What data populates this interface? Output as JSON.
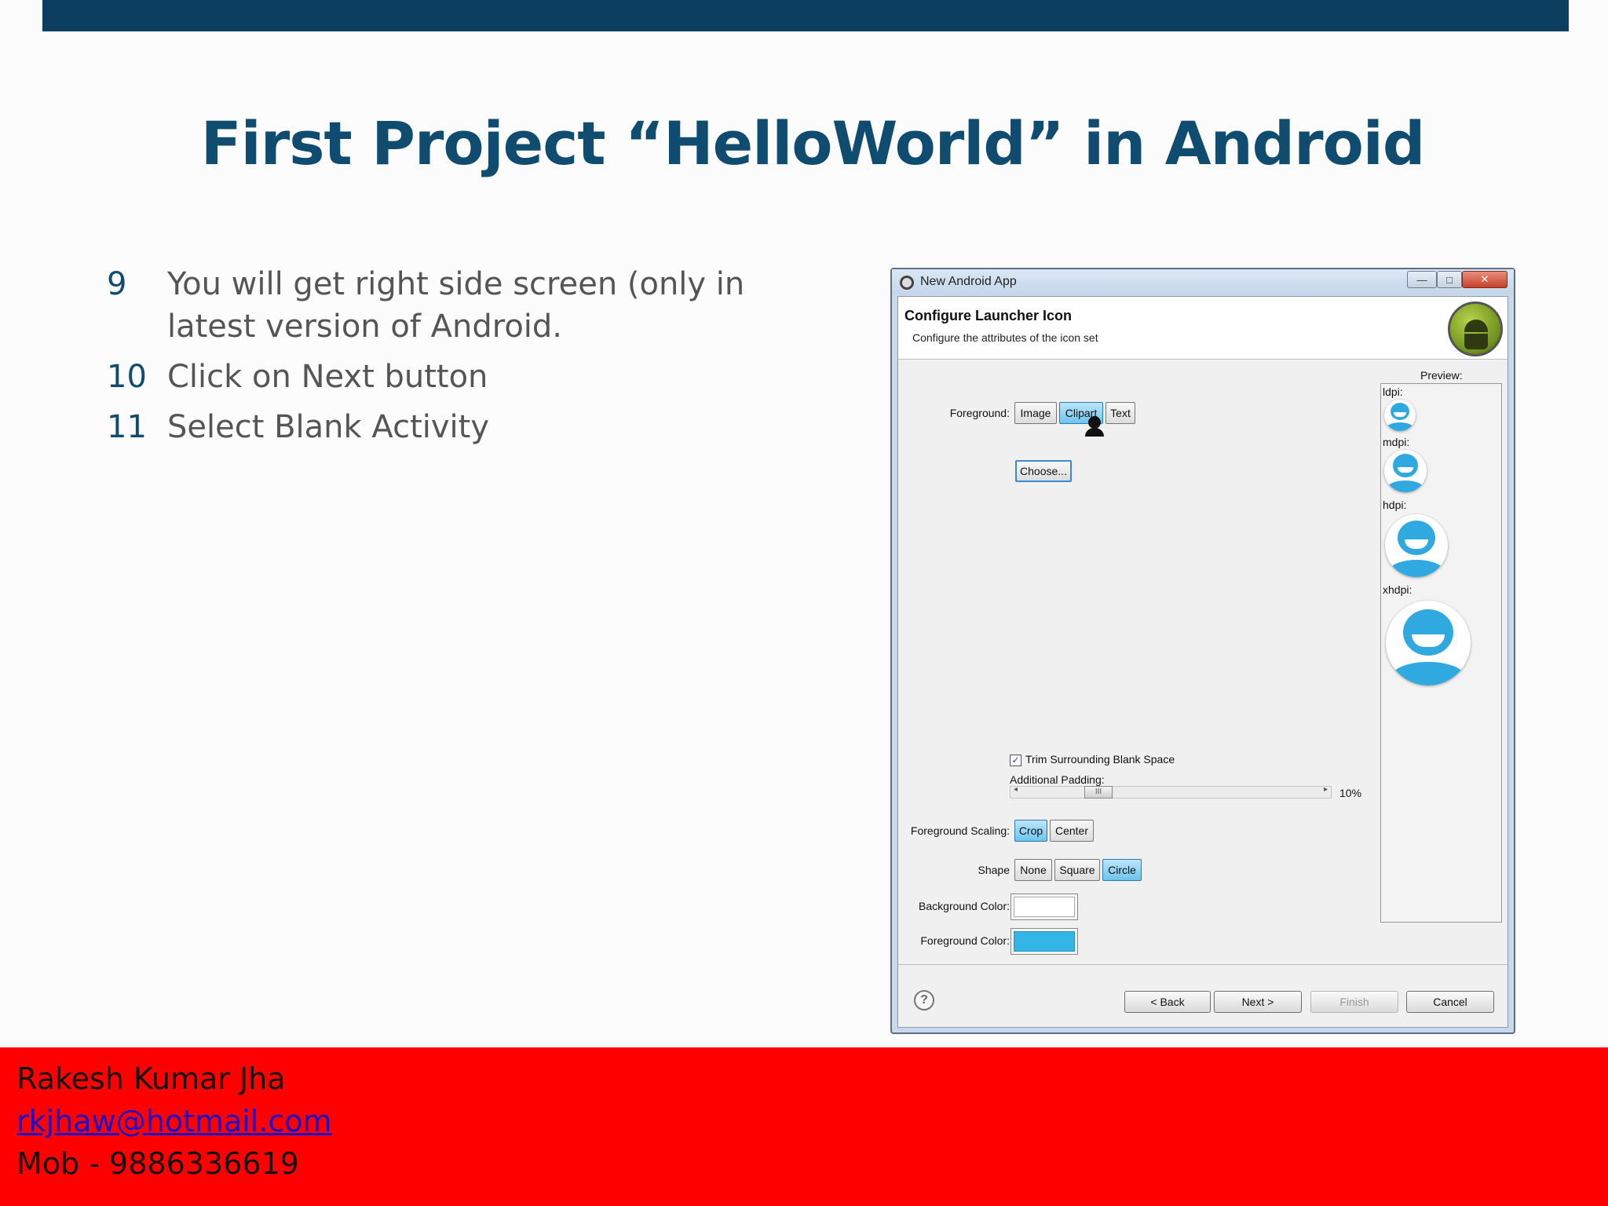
{
  "slide": {
    "title": "First Project “HelloWorld” in Android",
    "bullets": [
      {
        "num": "9",
        "text": "You will get right side screen (only in latest version of Android."
      },
      {
        "num": "10",
        "text": "Click on Next button"
      },
      {
        "num": "11",
        "text": "Select Blank Activity"
      }
    ]
  },
  "dialog": {
    "window_title": "New Android App",
    "header_title": "Configure Launcher Icon",
    "header_subtitle": "Configure the attributes of the icon set",
    "foreground": {
      "label": "Foreground:",
      "options": [
        "Image",
        "Clipart",
        "Text"
      ],
      "selected": "Clipart"
    },
    "choose_label": "Choose...",
    "trim": {
      "label": "Trim Surrounding Blank Space",
      "checked": true
    },
    "padding": {
      "label": "Additional Padding:",
      "value": "10%",
      "thumb": "III"
    },
    "scaling": {
      "label": "Foreground Scaling:",
      "options": [
        "Crop",
        "Center"
      ],
      "selected": "Crop"
    },
    "shape": {
      "label": "Shape",
      "options": [
        "None",
        "Square",
        "Circle"
      ],
      "selected": "Circle"
    },
    "background_color": {
      "label": "Background Color:",
      "value": "#ffffff"
    },
    "foreground_color": {
      "label": "Foreground Color:",
      "value": "#33b5e5"
    },
    "preview": {
      "label": "Preview:",
      "densities": [
        "ldpi:",
        "mdpi:",
        "hdpi:",
        "xhdpi:"
      ]
    },
    "buttons": {
      "back": "< Back",
      "next": "Next >",
      "finish": "Finish",
      "cancel": "Cancel"
    },
    "help_icon": "?",
    "window_controls": {
      "minimize": "—",
      "maximize": "□",
      "close": "✕"
    }
  },
  "footer": {
    "name": "Rakesh Kumar Jha",
    "email": "rkjhaw@hotmail.com",
    "mobile": "Mob - 9886336619"
  },
  "colors": {
    "top_bar": "#0b3e5f",
    "title": "#0f4c6f",
    "footer_bg": "#ff0000",
    "accent": "#33b5e5"
  }
}
